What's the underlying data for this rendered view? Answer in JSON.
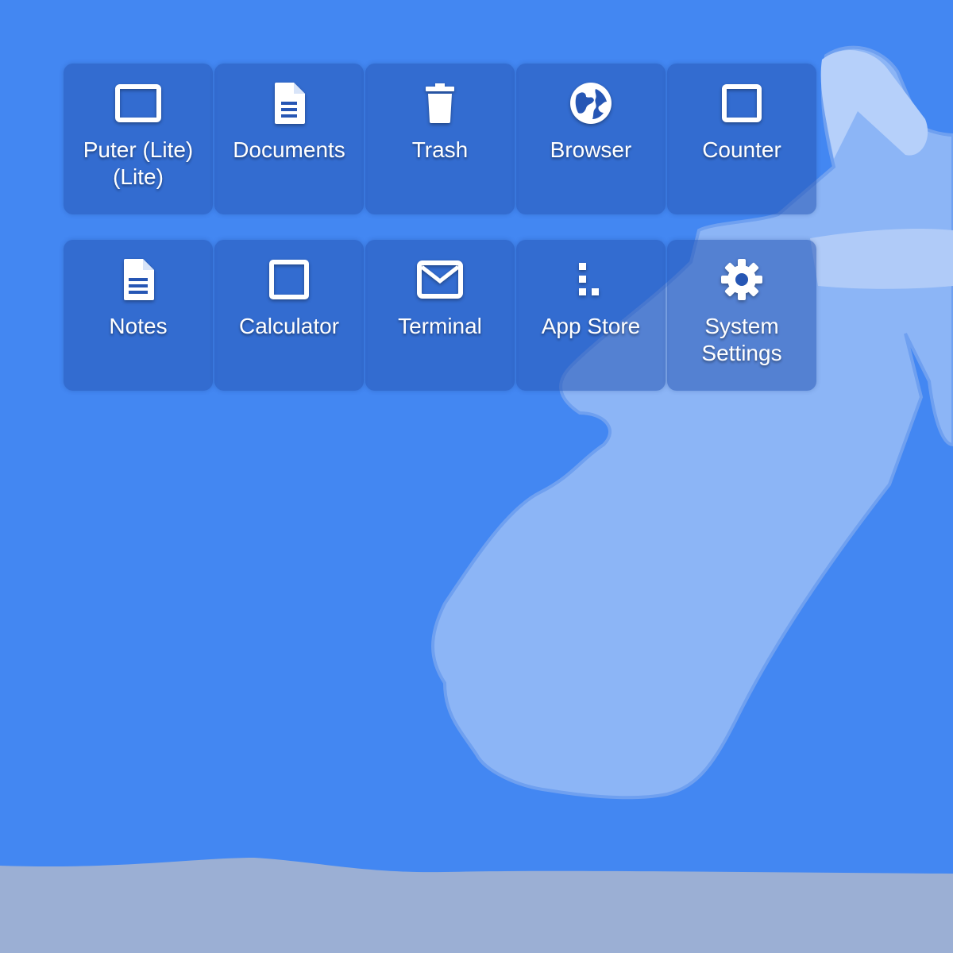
{
  "theme": {
    "background": "#4387f2",
    "tile_background": "#2656b4",
    "wallpaper_shape": "#8cb5f6",
    "ground": "#9bafd4"
  },
  "desktop": {
    "apps": [
      {
        "label": "Puter (Lite) (Lite)",
        "icon": "window-icon"
      },
      {
        "label": "Documents",
        "icon": "document-icon"
      },
      {
        "label": "Trash",
        "icon": "trash-icon"
      },
      {
        "label": "Browser",
        "icon": "globe-icon"
      },
      {
        "label": "Counter",
        "icon": "window-icon"
      },
      {
        "label": "Notes",
        "icon": "document-icon"
      },
      {
        "label": "Calculator",
        "icon": "square-icon"
      },
      {
        "label": "Terminal",
        "icon": "envelope-icon"
      },
      {
        "label": "App Store",
        "icon": "blocks-icon"
      },
      {
        "label": "System Settings",
        "icon": "gear-icon"
      }
    ]
  }
}
